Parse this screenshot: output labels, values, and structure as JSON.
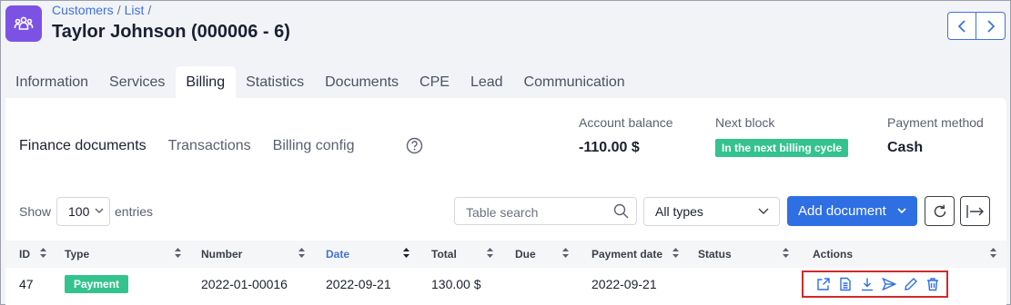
{
  "breadcrumb": {
    "customers": "Customers",
    "list": "List",
    "separator": "/"
  },
  "page": {
    "title": "Taylor Johnson (000006 - 6)"
  },
  "tabs": [
    {
      "label": "Information"
    },
    {
      "label": "Services"
    },
    {
      "label": "Billing",
      "active": true
    },
    {
      "label": "Statistics"
    },
    {
      "label": "Documents"
    },
    {
      "label": "CPE"
    },
    {
      "label": "Lead"
    },
    {
      "label": "Communication"
    }
  ],
  "subtabs": [
    {
      "label": "Finance documents",
      "active": true
    },
    {
      "label": "Transactions"
    },
    {
      "label": "Billing config"
    }
  ],
  "summary": {
    "balance_label": "Account balance",
    "balance_value": "-110.00 $",
    "next_block_label": "Next block",
    "next_block_value": "In the next billing cycle",
    "payment_method_label": "Payment method",
    "payment_method_value": "Cash"
  },
  "controls": {
    "show_label": "Show",
    "entries_value": "100",
    "entries_label": "entries",
    "search_placeholder": "Table search",
    "type_filter": "All types",
    "add_document": "Add document"
  },
  "table": {
    "columns": [
      "ID",
      "Type",
      "Number",
      "Date",
      "Total",
      "Due",
      "Payment date",
      "Status",
      "Actions"
    ],
    "rows": [
      {
        "id": "47",
        "type": "Payment",
        "number": "2022-01-00016",
        "date": "2022-09-21",
        "total": "130.00 $",
        "due": "",
        "payment_date": "2022-09-21",
        "status": ""
      }
    ]
  },
  "icons": {
    "app": "customers-group-icon",
    "help": "help-icon",
    "actions": [
      "open-external-icon",
      "document-icon",
      "download-icon",
      "send-icon",
      "edit-icon",
      "delete-icon"
    ]
  },
  "colors": {
    "accent": "#2f6fe4",
    "app_icon": "#7c52e5",
    "success": "#34c38f",
    "highlight": "#d12a2a"
  }
}
